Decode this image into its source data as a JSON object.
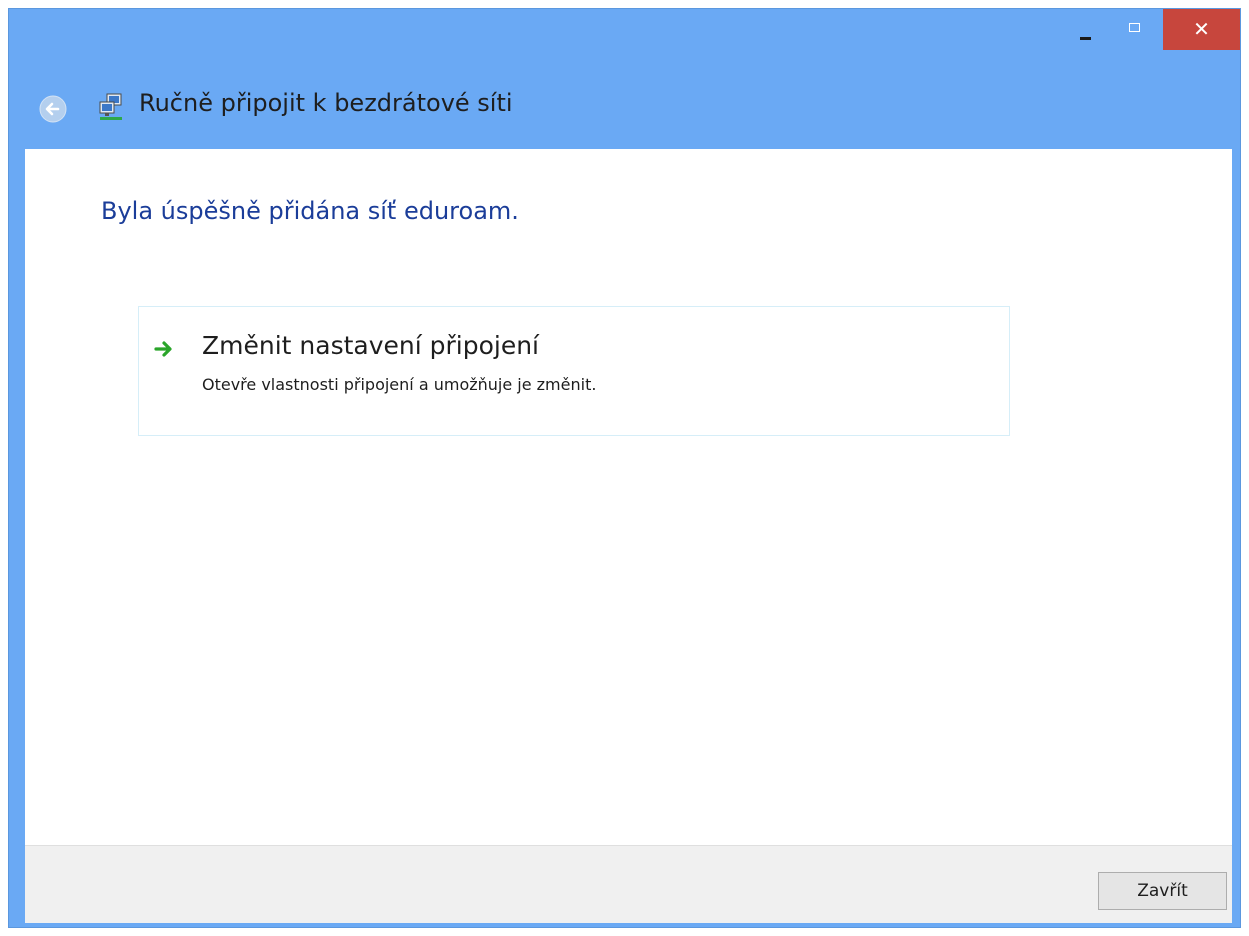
{
  "window": {
    "title": "Ručně připojit k bezdrátové síti",
    "close_glyph": "✕",
    "controls": [
      "minimize-icon",
      "maximize-icon",
      "close-icon"
    ]
  },
  "navigation": {
    "back_icon": "back-arrow-icon",
    "title_icon": "network-icon"
  },
  "main": {
    "heading": "Byla úspěšně přidána síť eduroam.",
    "option": {
      "icon": "green-arrow-icon",
      "title": "Změnit nastavení připojení",
      "description": "Otevře vlastnosti připojení a umožňuje je změnit."
    }
  },
  "footer": {
    "close_label": "Zavřít"
  },
  "colors": {
    "titlebar": "#6aa9f4",
    "close_button": "#c7463d",
    "heading_text": "#1b3d99",
    "option_border": "#d6eef8",
    "arrow_green": "#2aa52a"
  }
}
